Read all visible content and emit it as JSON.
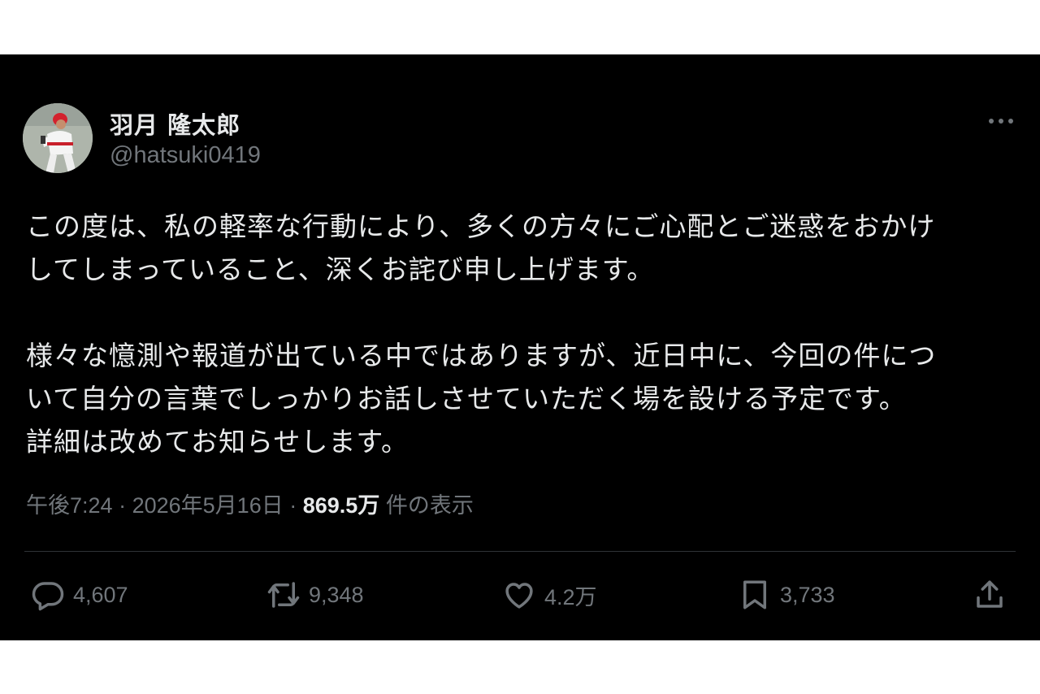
{
  "author": {
    "display_name": "羽月 隆太郎",
    "handle": "@hatsuki0419"
  },
  "tweet": {
    "paragraphs": [
      [
        "この度は、私の軽率な行動により、多くの方々にご心配とご迷惑をおかけ",
        "してしまっていること、深くお詫び申し上げます。"
      ],
      [
        "様々な憶測や報道が出ている中ではありますが、近日中に、今回の件につ",
        "いて自分の言葉でしっかりお話しさせていただく場を設ける予定です。",
        "詳細は改めてお知らせします。"
      ]
    ]
  },
  "meta": {
    "time": "午後7:24",
    "separator": "·",
    "date": "2026年5月16日",
    "views": "869.5万",
    "views_label": "件の表示"
  },
  "actions": {
    "replies": "4,607",
    "reposts": "9,348",
    "likes": "4.2万",
    "bookmarks": "3,733"
  },
  "colors": {
    "background": "#000000",
    "text": "#e7e9ea",
    "muted": "#71767b",
    "divider": "#2f3336"
  },
  "icons": [
    "more-icon",
    "reply-icon",
    "repost-icon",
    "like-icon",
    "bookmark-icon",
    "share-icon"
  ]
}
